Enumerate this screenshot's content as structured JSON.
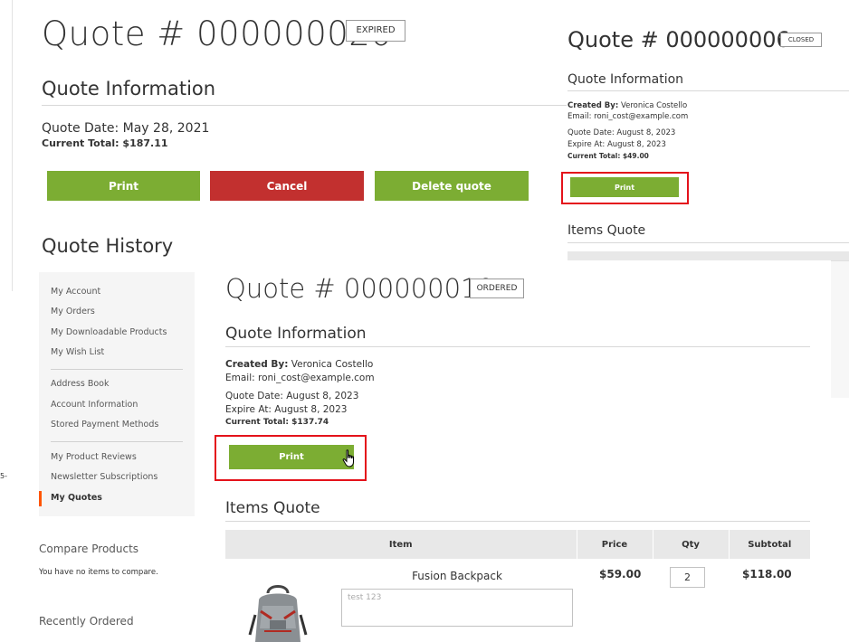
{
  "panel_expired": {
    "title": "Quote # 000000020",
    "status": "EXPIRED",
    "info_title": "Quote Information",
    "quote_date": "Quote Date: May 28, 2021",
    "current_total": "Current Total: $187.11",
    "buttons": {
      "print": "Print",
      "cancel": "Cancel",
      "delete": "Delete quote"
    },
    "history_title": "Quote History"
  },
  "panel_closed": {
    "title": "Quote # 000000006",
    "status": "CLOSED",
    "info_title": "Quote Information",
    "created_by_label": "Created By:",
    "created_by_value": "Veronica Costello",
    "email": "Email: roni_cost@example.com",
    "quote_date": "Quote Date: August 8, 2023",
    "expire_at": "Expire At: August 8, 2023",
    "current_total": "Current Total: $49.00",
    "print_label": "Print",
    "items_title": "Items Quote"
  },
  "sidebar": {
    "group1": [
      "My Account",
      "My Orders",
      "My Downloadable Products",
      "My Wish List"
    ],
    "group2": [
      "Address Book",
      "Account Information",
      "Stored Payment Methods"
    ],
    "group3": [
      "My Product Reviews",
      "Newsletter Subscriptions",
      "My Quotes"
    ],
    "active": "My Quotes",
    "compare_title": "Compare Products",
    "compare_empty": "You have no items to compare.",
    "recent_title": "Recently Ordered",
    "stray_text": "5-"
  },
  "panel_ordered": {
    "title": "Quote # 000000010",
    "status": "ORDERED",
    "info_title": "Quote Information",
    "created_by_label": "Created By:",
    "created_by_value": "Veronica Costello",
    "email": "Email: roni_cost@example.com",
    "quote_date": "Quote Date: August 8, 2023",
    "expire_at": "Expire At: August 8, 2023",
    "current_total": "Current Total: $137.74",
    "print_label": "Print",
    "items_title": "Items Quote",
    "table": {
      "columns": [
        "Item",
        "Price",
        "Qty",
        "Subtotal"
      ],
      "rows": [
        {
          "name": "Fusion Backpack",
          "price": "$59.00",
          "qty": "2",
          "subtotal": "$118.00",
          "note": "test 123"
        }
      ]
    }
  },
  "colors": {
    "green": "#7cad33",
    "red": "#c2302f",
    "highlight": "#e4121b",
    "active_nav": "#ff5501"
  }
}
